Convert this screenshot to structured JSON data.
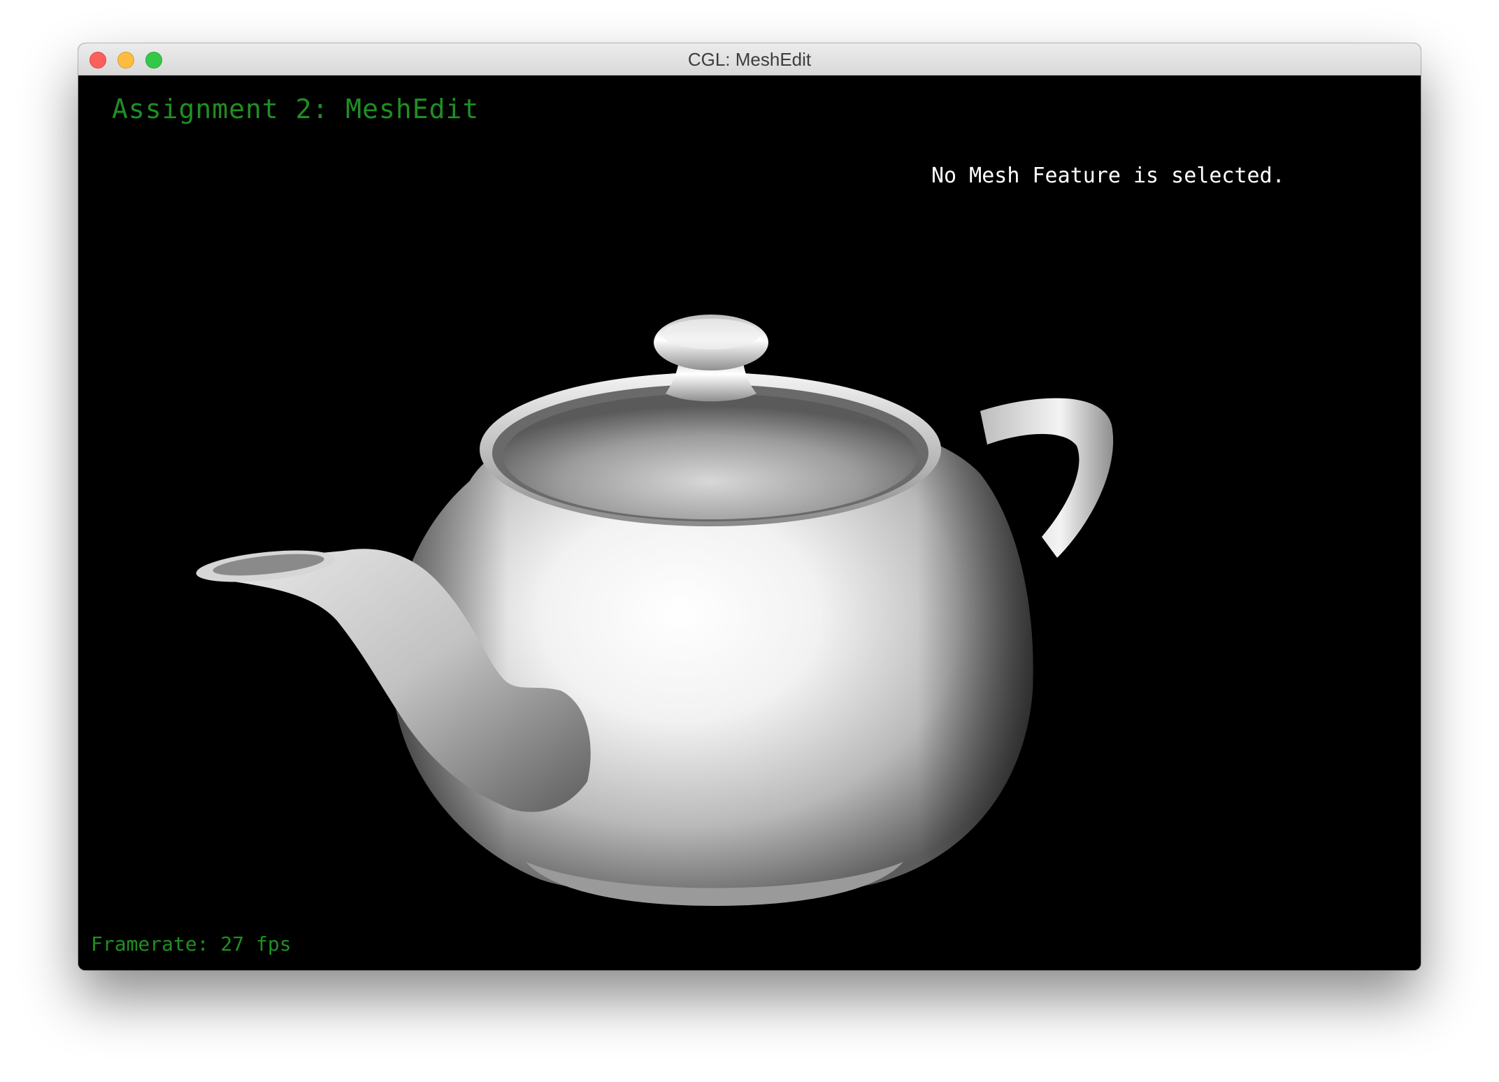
{
  "window": {
    "title": "CGL: MeshEdit"
  },
  "viewport": {
    "title": "Assignment 2: MeshEdit",
    "selection_status": "No Mesh Feature is selected.",
    "framerate": "Framerate: 27 fps",
    "background_color": "#000000",
    "accent_color": "#1f8f22"
  },
  "traffic_lights": [
    "close",
    "minimize",
    "maximize"
  ]
}
